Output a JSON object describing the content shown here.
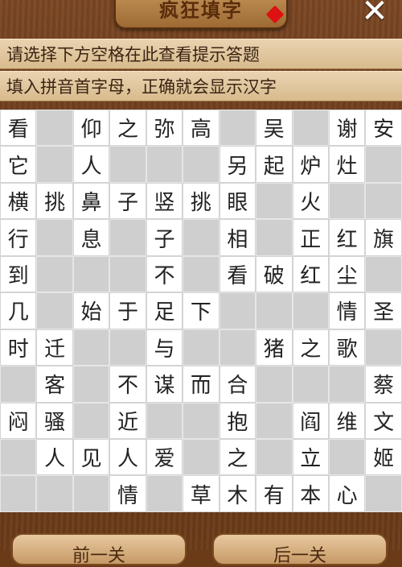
{
  "header": {
    "title": "疯狂填字",
    "close_label": "✕"
  },
  "hints": {
    "line1": "请选择下方空格在此查看提示答题",
    "line2": "填入拼音首字母，正确就会显示汉字"
  },
  "grid": [
    [
      "看",
      "",
      "仰",
      "之",
      "弥",
      "高",
      "",
      "吴",
      "",
      "谢",
      "安"
    ],
    [
      "它",
      "",
      "人",
      "",
      "",
      "",
      "另",
      "起",
      "炉",
      "灶",
      ""
    ],
    [
      "横",
      "挑",
      "鼻",
      "子",
      "竖",
      "挑",
      "眼",
      "",
      "火",
      "",
      ""
    ],
    [
      "行",
      "",
      "息",
      "",
      "子",
      "",
      "相",
      "",
      "正",
      "红",
      "旗"
    ],
    [
      "到",
      "",
      "",
      "",
      "不",
      "",
      "看",
      "破",
      "红",
      "尘",
      ""
    ],
    [
      "几",
      "",
      "始",
      "于",
      "足",
      "下",
      "",
      "",
      "",
      "情",
      "圣"
    ],
    [
      "时",
      "迁",
      "",
      "",
      "与",
      "",
      "",
      "猪",
      "之",
      "歌",
      ""
    ],
    [
      "",
      "客",
      "",
      "不",
      "谋",
      "而",
      "合",
      "",
      "",
      "",
      "蔡"
    ],
    [
      "闷",
      "骚",
      "",
      "近",
      "",
      "",
      "抱",
      "",
      "阎",
      "维",
      "文"
    ],
    [
      "",
      "人",
      "见",
      "人",
      "爱",
      "",
      "之",
      "",
      "立",
      "",
      "姬"
    ],
    [
      "",
      "",
      "",
      "情",
      "",
      "草",
      "木",
      "有",
      "本",
      "心",
      ""
    ]
  ],
  "cell_types": [
    "WGWWWWGWGWW",
    "WGWGGGWWWWG",
    "WWWWWWWGWGG",
    "WGWGWGWGWWW",
    "WGGGWGWWWWG",
    "WGWWWWGGGWW",
    "WWGGWGGWWWG",
    "GWGWWWWGGGW",
    "WWGWGGWGWWW",
    "GWWWWGWGWGW",
    "GGGWGWWWWWG"
  ],
  "buttons": {
    "prev_label": "前一关",
    "next_label": "后一关"
  }
}
